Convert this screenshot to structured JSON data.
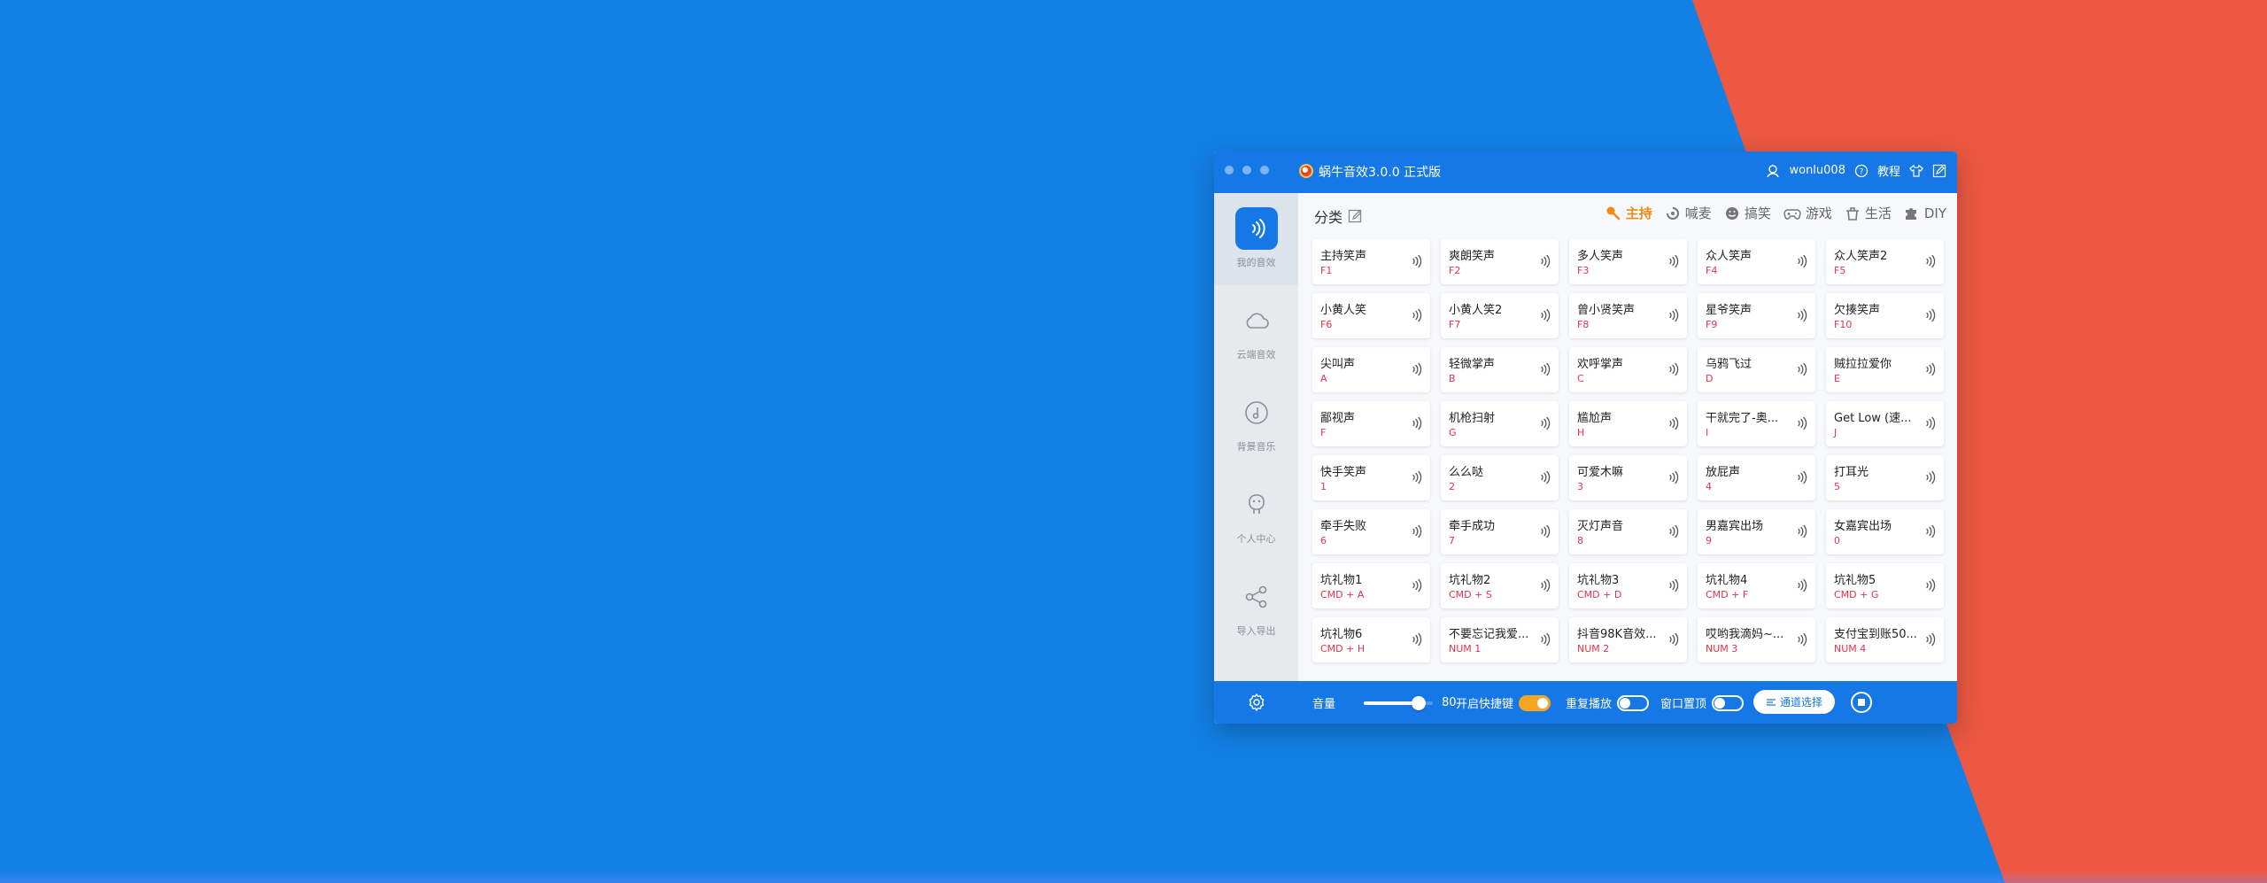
{
  "window": {
    "title": "蜗牛音效3.0.0 正式版",
    "username": "wonlu008",
    "tutorial_label": "教程"
  },
  "sidebar": {
    "items": [
      {
        "label": "我的音效",
        "icon": "sound-wave-icon",
        "active": true
      },
      {
        "label": "云端音效",
        "icon": "cloud-icon",
        "active": false
      },
      {
        "label": "背景音乐",
        "icon": "music-disc-icon",
        "active": false
      },
      {
        "label": "个人中心",
        "icon": "person-icon",
        "active": false
      },
      {
        "label": "导入导出",
        "icon": "share-icon",
        "active": false
      }
    ],
    "settings_icon": "gear-icon"
  },
  "main": {
    "category_label": "分类",
    "tabs": [
      {
        "label": "主持",
        "icon": "host-icon",
        "active": true
      },
      {
        "label": "喊麦",
        "icon": "mic-icon",
        "active": false
      },
      {
        "label": "搞笑",
        "icon": "laugh-icon",
        "active": false
      },
      {
        "label": "游戏",
        "icon": "gamepad-icon",
        "active": false
      },
      {
        "label": "生活",
        "icon": "life-icon",
        "active": false
      },
      {
        "label": "DIY",
        "icon": "puzzle-icon",
        "active": false
      }
    ],
    "sounds": [
      {
        "name": "主持笑声",
        "key": "F1"
      },
      {
        "name": "爽朗笑声",
        "key": "F2"
      },
      {
        "name": "多人笑声",
        "key": "F3"
      },
      {
        "name": "众人笑声",
        "key": "F4"
      },
      {
        "name": "众人笑声2",
        "key": "F5"
      },
      {
        "name": "小黄人笑",
        "key": "F6"
      },
      {
        "name": "小黄人笑2",
        "key": "F7"
      },
      {
        "name": "曾小贤笑声",
        "key": "F8"
      },
      {
        "name": "星爷笑声",
        "key": "F9"
      },
      {
        "name": "欠揍笑声",
        "key": "F10"
      },
      {
        "name": "尖叫声",
        "key": "A"
      },
      {
        "name": "轻微掌声",
        "key": "B"
      },
      {
        "name": "欢呼掌声",
        "key": "C"
      },
      {
        "name": "乌鸦飞过",
        "key": "D"
      },
      {
        "name": "贼拉拉爱你",
        "key": "E"
      },
      {
        "name": "鄙视声",
        "key": "F"
      },
      {
        "name": "机枪扫射",
        "key": "G"
      },
      {
        "name": "尴尬声",
        "key": "H"
      },
      {
        "name": "干就完了-奥...",
        "key": "I"
      },
      {
        "name": "Get Low (速...",
        "key": "J"
      },
      {
        "name": "快手笑声",
        "key": "1"
      },
      {
        "name": "么么哒",
        "key": "2"
      },
      {
        "name": "可爱木嘛",
        "key": "3"
      },
      {
        "name": "放屁声",
        "key": "4"
      },
      {
        "name": "打耳光",
        "key": "5"
      },
      {
        "name": "牵手失败",
        "key": "6"
      },
      {
        "name": "牵手成功",
        "key": "7"
      },
      {
        "name": "灭灯声音",
        "key": "8"
      },
      {
        "name": "男嘉宾出场",
        "key": "9"
      },
      {
        "name": "女嘉宾出场",
        "key": "0"
      },
      {
        "name": "坑礼物1",
        "key": "CMD + A"
      },
      {
        "name": "坑礼物2",
        "key": "CMD + S"
      },
      {
        "name": "坑礼物3",
        "key": "CMD + D"
      },
      {
        "name": "坑礼物4",
        "key": "CMD + F"
      },
      {
        "name": "坑礼物5",
        "key": "CMD + G"
      },
      {
        "name": "坑礼物6",
        "key": "CMD + H"
      },
      {
        "name": "不要忘记我爱...",
        "key": "NUM 1"
      },
      {
        "name": "抖音98K音效...",
        "key": "NUM 2"
      },
      {
        "name": "哎哟我滴妈~...",
        "key": "NUM 3"
      },
      {
        "name": "支付宝到账50...",
        "key": "NUM 4"
      }
    ]
  },
  "footer": {
    "volume_label": "音量",
    "volume_value": "80",
    "volume_fraction": 0.8,
    "hotkey_label": "开启快捷键",
    "hotkey_on": true,
    "repeat_label": "重复播放",
    "repeat_on": false,
    "ontop_label": "窗口置顶",
    "ontop_on": false,
    "channel_label": "通道选择"
  },
  "colors": {
    "background_blue": "#1380e6",
    "background_red": "#ec5842",
    "accent_blue": "#1677e6",
    "active_tab": "#f08a17",
    "hotkey_red": "#e0344b",
    "toggle_on": "#f5a623"
  }
}
